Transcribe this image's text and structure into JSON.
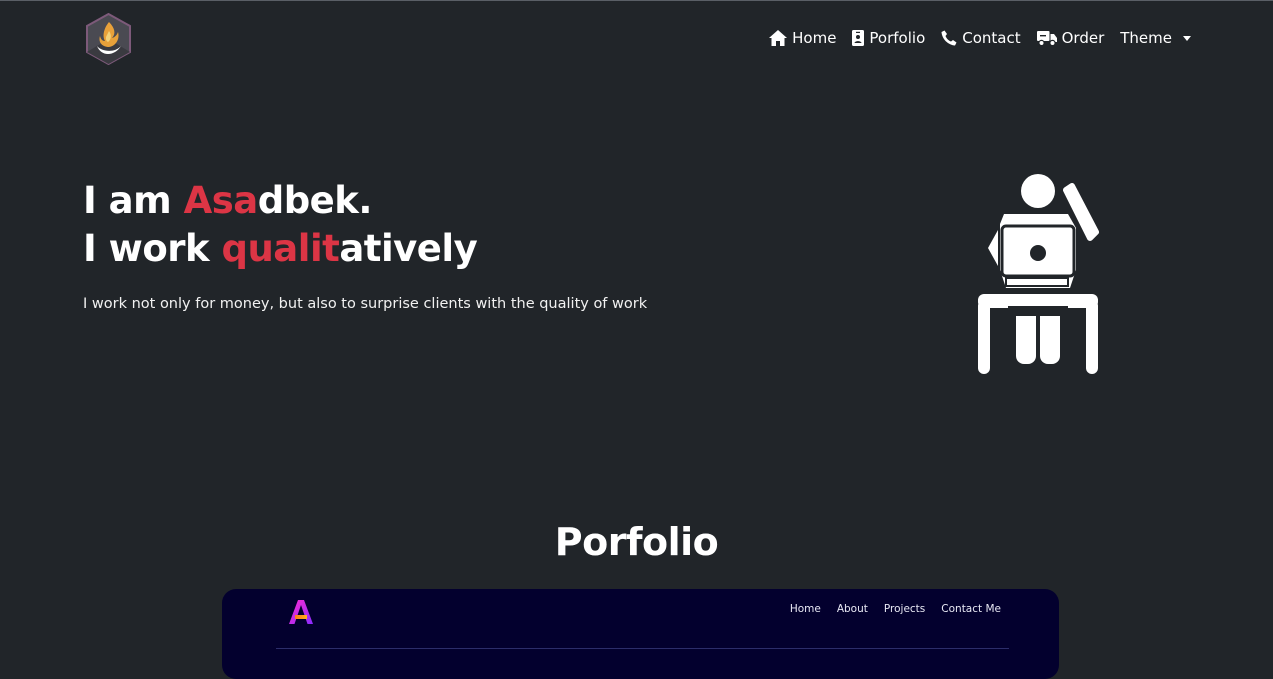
{
  "nav": {
    "items": [
      {
        "label": "Home",
        "icon": "home-icon"
      },
      {
        "label": "Porfolio",
        "icon": "id-badge-icon"
      },
      {
        "label": "Contact",
        "icon": "phone-icon"
      },
      {
        "label": "Order",
        "icon": "truck-icon"
      },
      {
        "label": "Theme",
        "icon": "caret-down-icon"
      }
    ]
  },
  "hero": {
    "line1_prefix": "I am ",
    "line1_accent": "Asa",
    "line1_rest": "dbek.",
    "line2_prefix": "I work ",
    "line2_accent": "qualit",
    "line2_rest": "atively",
    "subtitle": "I work not only for money, but also to surprise clients with the quality of work"
  },
  "portfolio": {
    "title": "Porfolio",
    "preview_nav": [
      "Home",
      "About",
      "Projects",
      "Contact Me"
    ]
  },
  "colors": {
    "background": "#212529",
    "accent": "#dc3545",
    "preview_bg": "#03002e"
  }
}
